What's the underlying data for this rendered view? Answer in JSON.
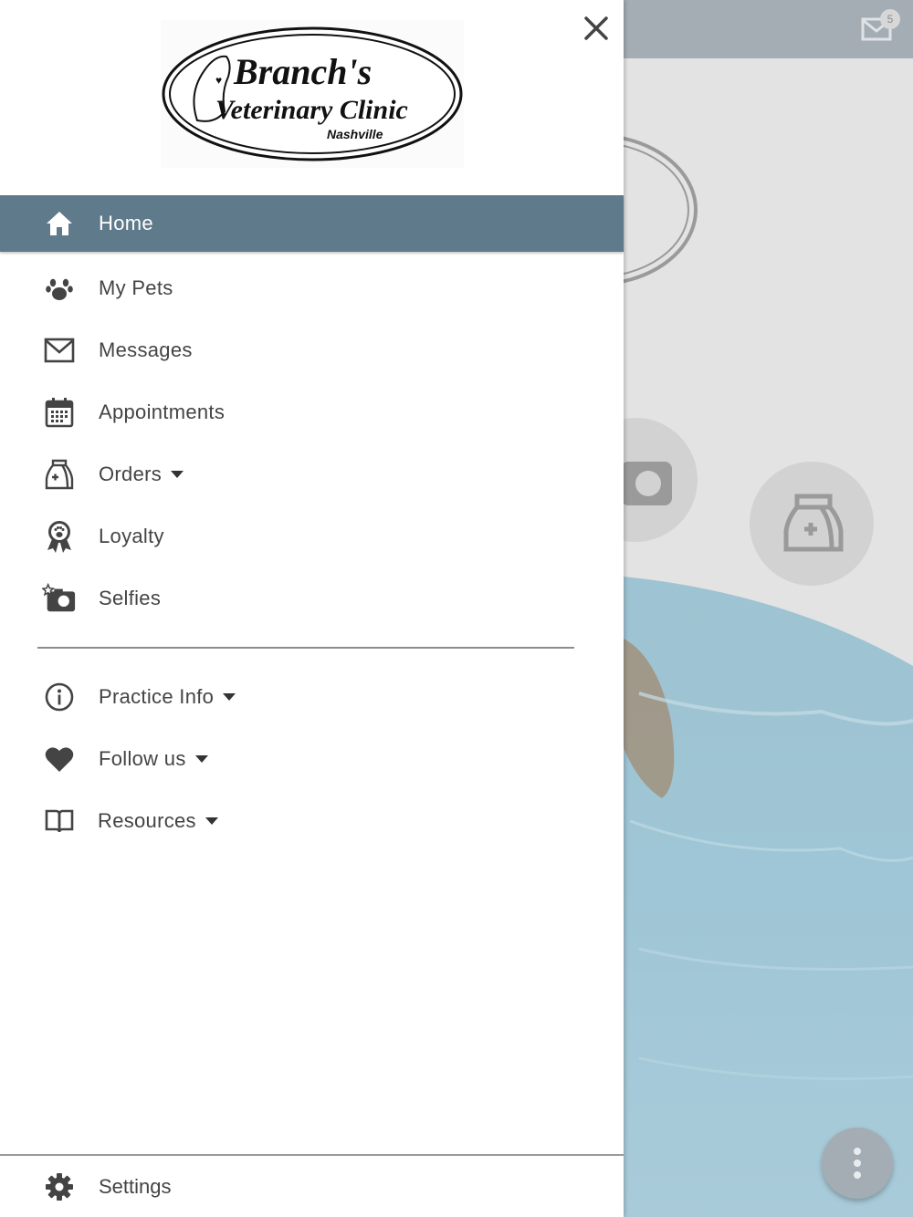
{
  "clinic": {
    "logo_line1": "Branch's",
    "logo_line2": "Veterinary Clinic",
    "logo_line3": "Nashville"
  },
  "header": {
    "unread_badge": "5"
  },
  "menu": {
    "primary": [
      {
        "label": "Home",
        "icon": "home-icon",
        "active": true
      },
      {
        "label": "My Pets",
        "icon": "paw-icon"
      },
      {
        "label": "Messages",
        "icon": "envelope-icon"
      },
      {
        "label": "Appointments",
        "icon": "calendar-icon"
      },
      {
        "label": "Orders",
        "icon": "medicine-bag-icon",
        "has_dropdown": true
      },
      {
        "label": "Loyalty",
        "icon": "ribbon-paw-icon"
      },
      {
        "label": "Selfies",
        "icon": "camera-star-icon"
      }
    ],
    "secondary": [
      {
        "label": "Practice Info",
        "icon": "info-icon",
        "has_dropdown": true
      },
      {
        "label": "Follow us",
        "icon": "heart-icon",
        "has_dropdown": true
      },
      {
        "label": "Resources",
        "icon": "book-icon",
        "has_dropdown": true
      }
    ],
    "settings_label": "Settings"
  },
  "colors": {
    "active_bg": "#5e7a8b",
    "topbar": "#a4adb4",
    "icon": "#444444"
  }
}
